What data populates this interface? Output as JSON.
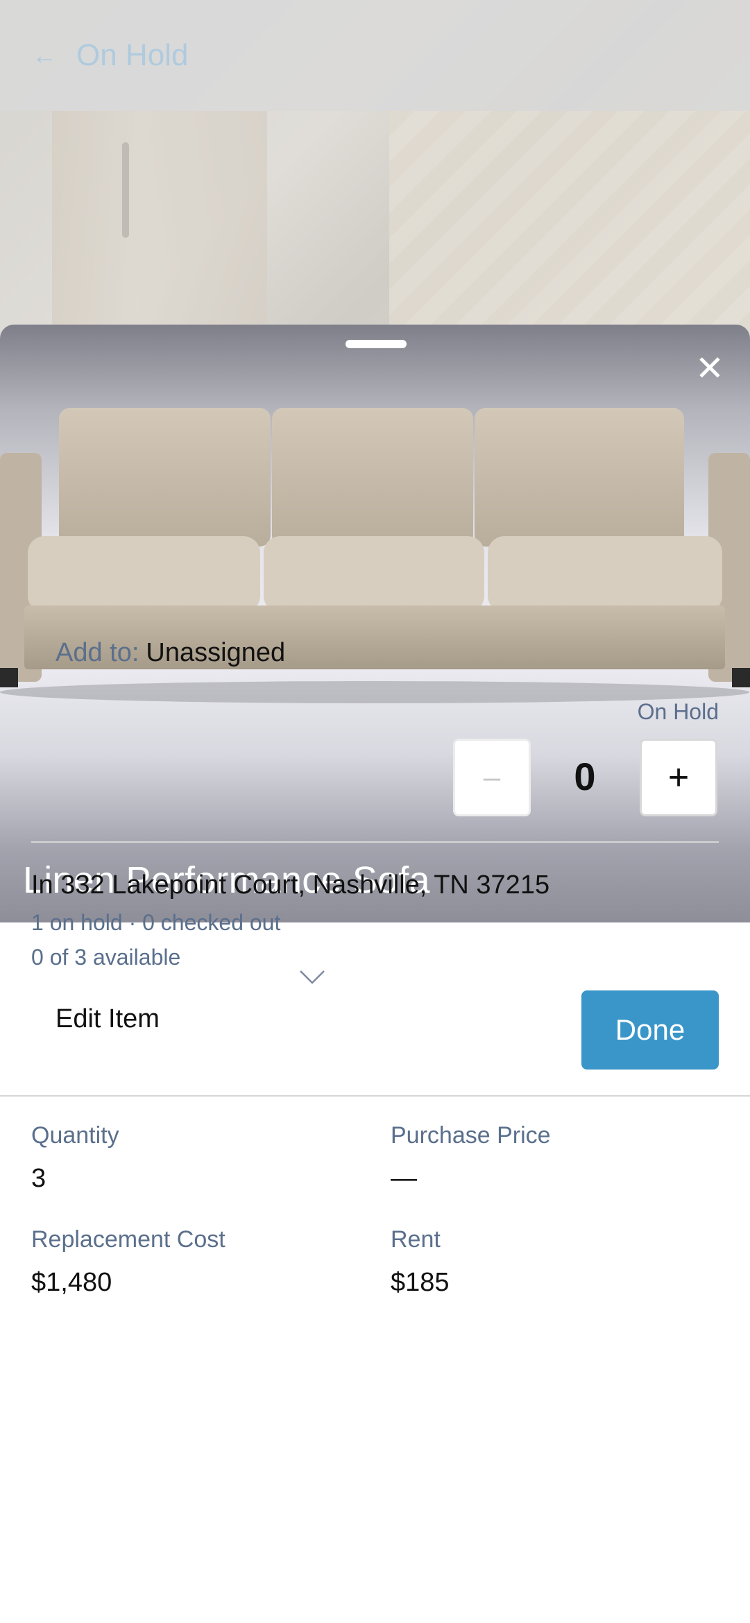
{
  "background_page": {
    "title": "On Hold"
  },
  "product": {
    "name": "Linen Performance Sofa"
  },
  "add_to": {
    "label": "Add to:",
    "value": "Unassigned"
  },
  "hold_control": {
    "label": "On Hold",
    "value": "0",
    "minus_label": "–",
    "plus_label": "+"
  },
  "location": {
    "address": "In 332 Lakepoint Court, Nashville, TN 37215",
    "status_line": "1 on hold · 0 checked out",
    "availability": "0 of 3 available"
  },
  "actions": {
    "edit_label": "Edit Item",
    "done_label": "Done"
  },
  "details": {
    "quantity_label": "Quantity",
    "quantity_value": "3",
    "purchase_price_label": "Purchase Price",
    "purchase_price_value": "—",
    "replacement_cost_label": "Replacement Cost",
    "replacement_cost_value": "$1,480",
    "rent_label": "Rent",
    "rent_value": "$185"
  },
  "colors": {
    "accent": "#3a96c9",
    "muted_text": "#5a6f8c"
  }
}
